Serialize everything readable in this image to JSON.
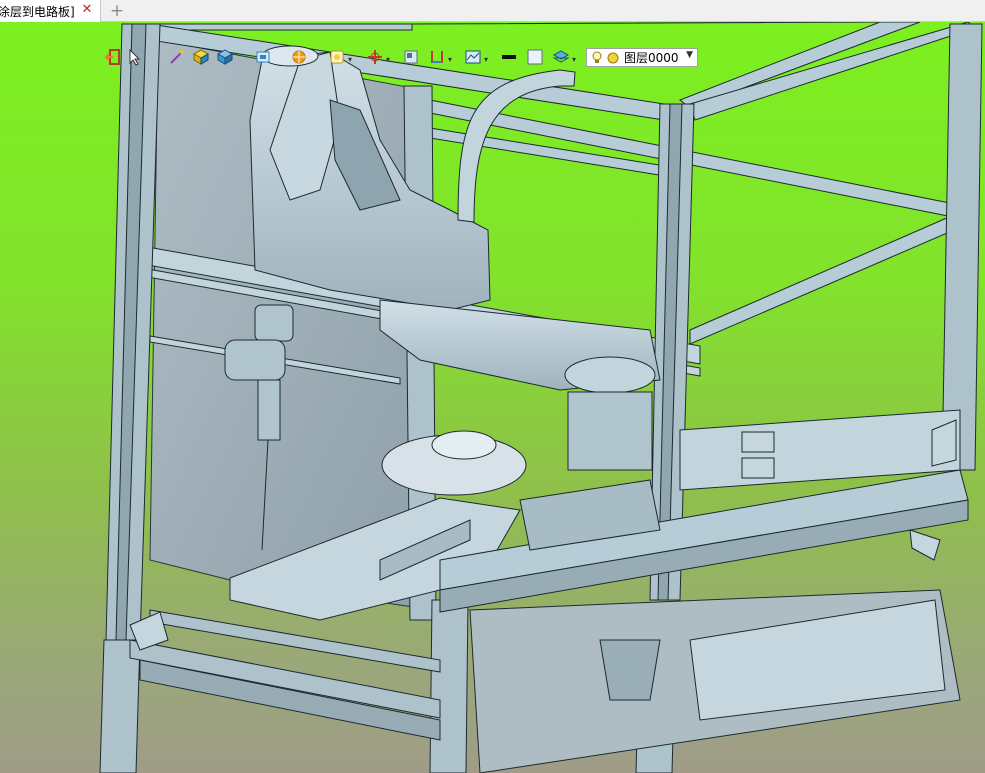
{
  "tab": {
    "title": "涂层到电路板]",
    "close_symbol": "✕",
    "new_tab_symbol": "+"
  },
  "toolbar": {
    "tools": [
      {
        "name": "exit-icon"
      },
      {
        "name": "pointer-icon"
      },
      {
        "name": "wand-icon"
      },
      {
        "name": "cube-yellow-icon"
      },
      {
        "name": "cube-blue-icon"
      },
      {
        "name": "component-icon"
      },
      {
        "name": "sun-icon"
      },
      {
        "name": "view-style-icon"
      },
      {
        "name": "axis-icon"
      },
      {
        "name": "section-icon"
      },
      {
        "name": "measure-icon"
      },
      {
        "name": "render-icon"
      },
      {
        "name": "color-black-icon"
      },
      {
        "name": "color-white-icon"
      },
      {
        "name": "layer-stack-icon"
      }
    ],
    "layer": {
      "current": "图层0000",
      "bulb_icon": "bulb-icon",
      "state_icon": "layer-state-icon"
    }
  },
  "colors": {
    "bg_top": "#7cf020",
    "bg_bottom": "#a09c88",
    "model": "#b6ccd6",
    "model_dark": "#6f8894",
    "edge": "#1c2a30"
  }
}
